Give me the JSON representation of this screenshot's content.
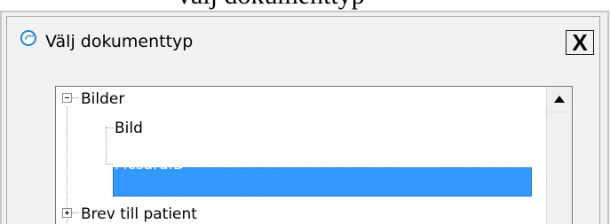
{
  "top_cut_text": "välj dokumenttyp",
  "dialog": {
    "title": "Välj dokumenttyp",
    "close_label": "X"
  },
  "tree": {
    "items": [
      {
        "label": "Bilder",
        "expander": "minus",
        "level": 0
      },
      {
        "label": "Bild",
        "level": 1
      },
      {
        "label": "PicsaraID",
        "level": 1,
        "selected": true
      },
      {
        "label": "Brev till patient",
        "expander": "plus",
        "level": 0
      }
    ]
  },
  "colors": {
    "selection": "#3399ff",
    "dialog_bg": "#f0f0f0",
    "icon_blue": "#1f86d1"
  },
  "icons": {
    "app": "app-logo-icon",
    "scroll_up": "scroll-up-arrow-icon"
  }
}
